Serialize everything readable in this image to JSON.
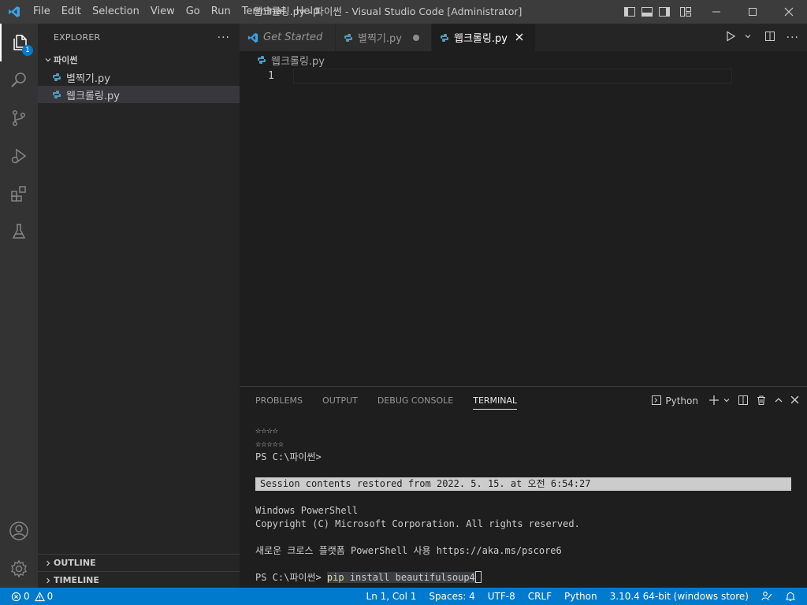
{
  "titlebar": {
    "menu": [
      "File",
      "Edit",
      "Selection",
      "View",
      "Go",
      "Run",
      "Terminal",
      "Help"
    ],
    "title": "웹크롤링.py - 파이썬 - Visual Studio Code [Administrator]"
  },
  "activity": {
    "badge": "1"
  },
  "sidebar": {
    "header": "EXPLORER",
    "more": "···",
    "folder": "파이썬",
    "files": [
      "별찍기.py",
      "웹크롤링.py"
    ],
    "outline": "OUTLINE",
    "timeline": "TIMELINE"
  },
  "tabs": [
    {
      "label": "Get Started"
    },
    {
      "label": "별찍기.py"
    },
    {
      "label": "웹크롤링.py"
    }
  ],
  "editor": {
    "breadcrumb": "웹크롤링.py",
    "line_number": "1"
  },
  "panel": {
    "tabs": [
      "PROBLEMS",
      "OUTPUT",
      "DEBUG CONSOLE",
      "TERMINAL"
    ],
    "shell": "Python",
    "terminal": {
      "line1": "☆☆☆☆",
      "line2": "☆☆☆☆☆",
      "line3": "PS C:\\파이썬>",
      "restored": "Session contents restored from 2022. 5. 15. at 오전 6:54:27",
      "ps_title": "Windows PowerShell",
      "copyright": "Copyright (C) Microsoft Corporation. All rights reserved.",
      "newps": "새로운 크로스 플랫폼 PowerShell 사용 https://aka.ms/pscore6",
      "prompt": "PS C:\\파이썬> ",
      "cmd": "pip",
      "args": " install beautifulsoup4"
    }
  },
  "statusbar": {
    "errors": "0",
    "warnings": "0",
    "position": "Ln 1, Col 1",
    "spaces": "Spaces: 4",
    "encoding": "UTF-8",
    "eol": "CRLF",
    "language": "Python",
    "interpreter": "3.10.4 64-bit (windows store)"
  }
}
